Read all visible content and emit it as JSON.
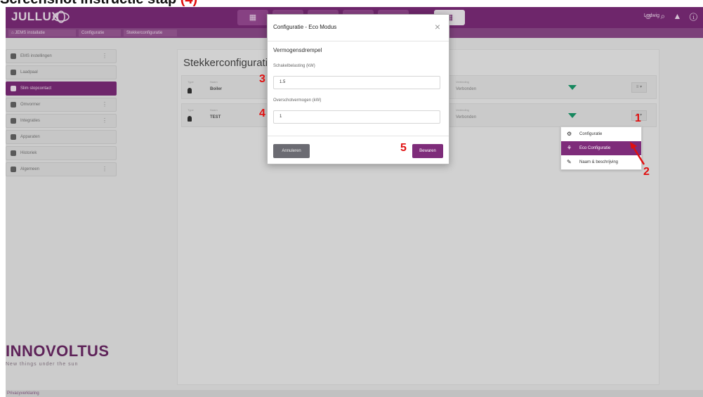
{
  "caption": {
    "text": "Screenshot instructie stap ",
    "highlight": "(4)"
  },
  "topbar": {
    "logo": "JULLUX",
    "icons": [
      "▦",
      "▦",
      "▦",
      "▦",
      "▦",
      "▦"
    ],
    "user": "Ludwig",
    "right_icons": "☺ ⌕ ▲ ⓘ"
  },
  "breadcrumb": [
    "⌂  JEMS installatie",
    "Configuratie",
    "Stekkerconfiguratie"
  ],
  "sidebar": {
    "items": [
      {
        "label": "EMS instellingen",
        "dots": "⋮"
      },
      {
        "label": "Laadpaal",
        "dots": ""
      },
      {
        "label": "Slim stopcontact",
        "dots": ""
      },
      {
        "label": "Omvormer",
        "dots": "⋮"
      },
      {
        "label": "Integraties",
        "dots": "⋮"
      },
      {
        "label": "Apparaten",
        "dots": ""
      },
      {
        "label": "Historiek",
        "dots": ""
      },
      {
        "label": "Algemeen",
        "dots": "⋮"
      }
    ]
  },
  "brand": {
    "name": "INNOVOLTUS",
    "slogan": "New things under the sun"
  },
  "footer": {
    "link": "Privacyverklaring"
  },
  "main": {
    "title": "Stekkerconfiguratie",
    "rows": [
      {
        "type_label": "Type",
        "name_label": "Naam",
        "name": "Boiler",
        "status_label": "Verbinding",
        "status": "Verbonden",
        "menu": "≡ ▾"
      },
      {
        "type_label": "Type",
        "name_label": "Naam",
        "name": "TEST",
        "status_label": "Verbinding",
        "status": "Verbonden",
        "menu": "≡ ▾"
      }
    ]
  },
  "dropdown": {
    "items": [
      {
        "label": "Configuratie",
        "icon": "⚙"
      },
      {
        "label": "Eco Configuratie",
        "icon": "⚘"
      },
      {
        "label": "Naam & beschrijving",
        "icon": "✎"
      }
    ]
  },
  "modal": {
    "title": "Configuratie - Eco Modus",
    "close": "×",
    "section": "Vermogensdrempel",
    "fields": [
      {
        "label": "Schakelbelasting (kW)",
        "value": "1.5"
      },
      {
        "label": "Overschotvermogen (kW)",
        "value": "1"
      }
    ],
    "cancel": "Annuleren",
    "save": "Bewaren"
  },
  "markers": [
    "1",
    "2",
    "3",
    "4",
    "5"
  ],
  "colors": {
    "brand_purple": "#7e2c7a",
    "marker_red": "#e01010",
    "wifi_green": "#1a9a6c"
  }
}
